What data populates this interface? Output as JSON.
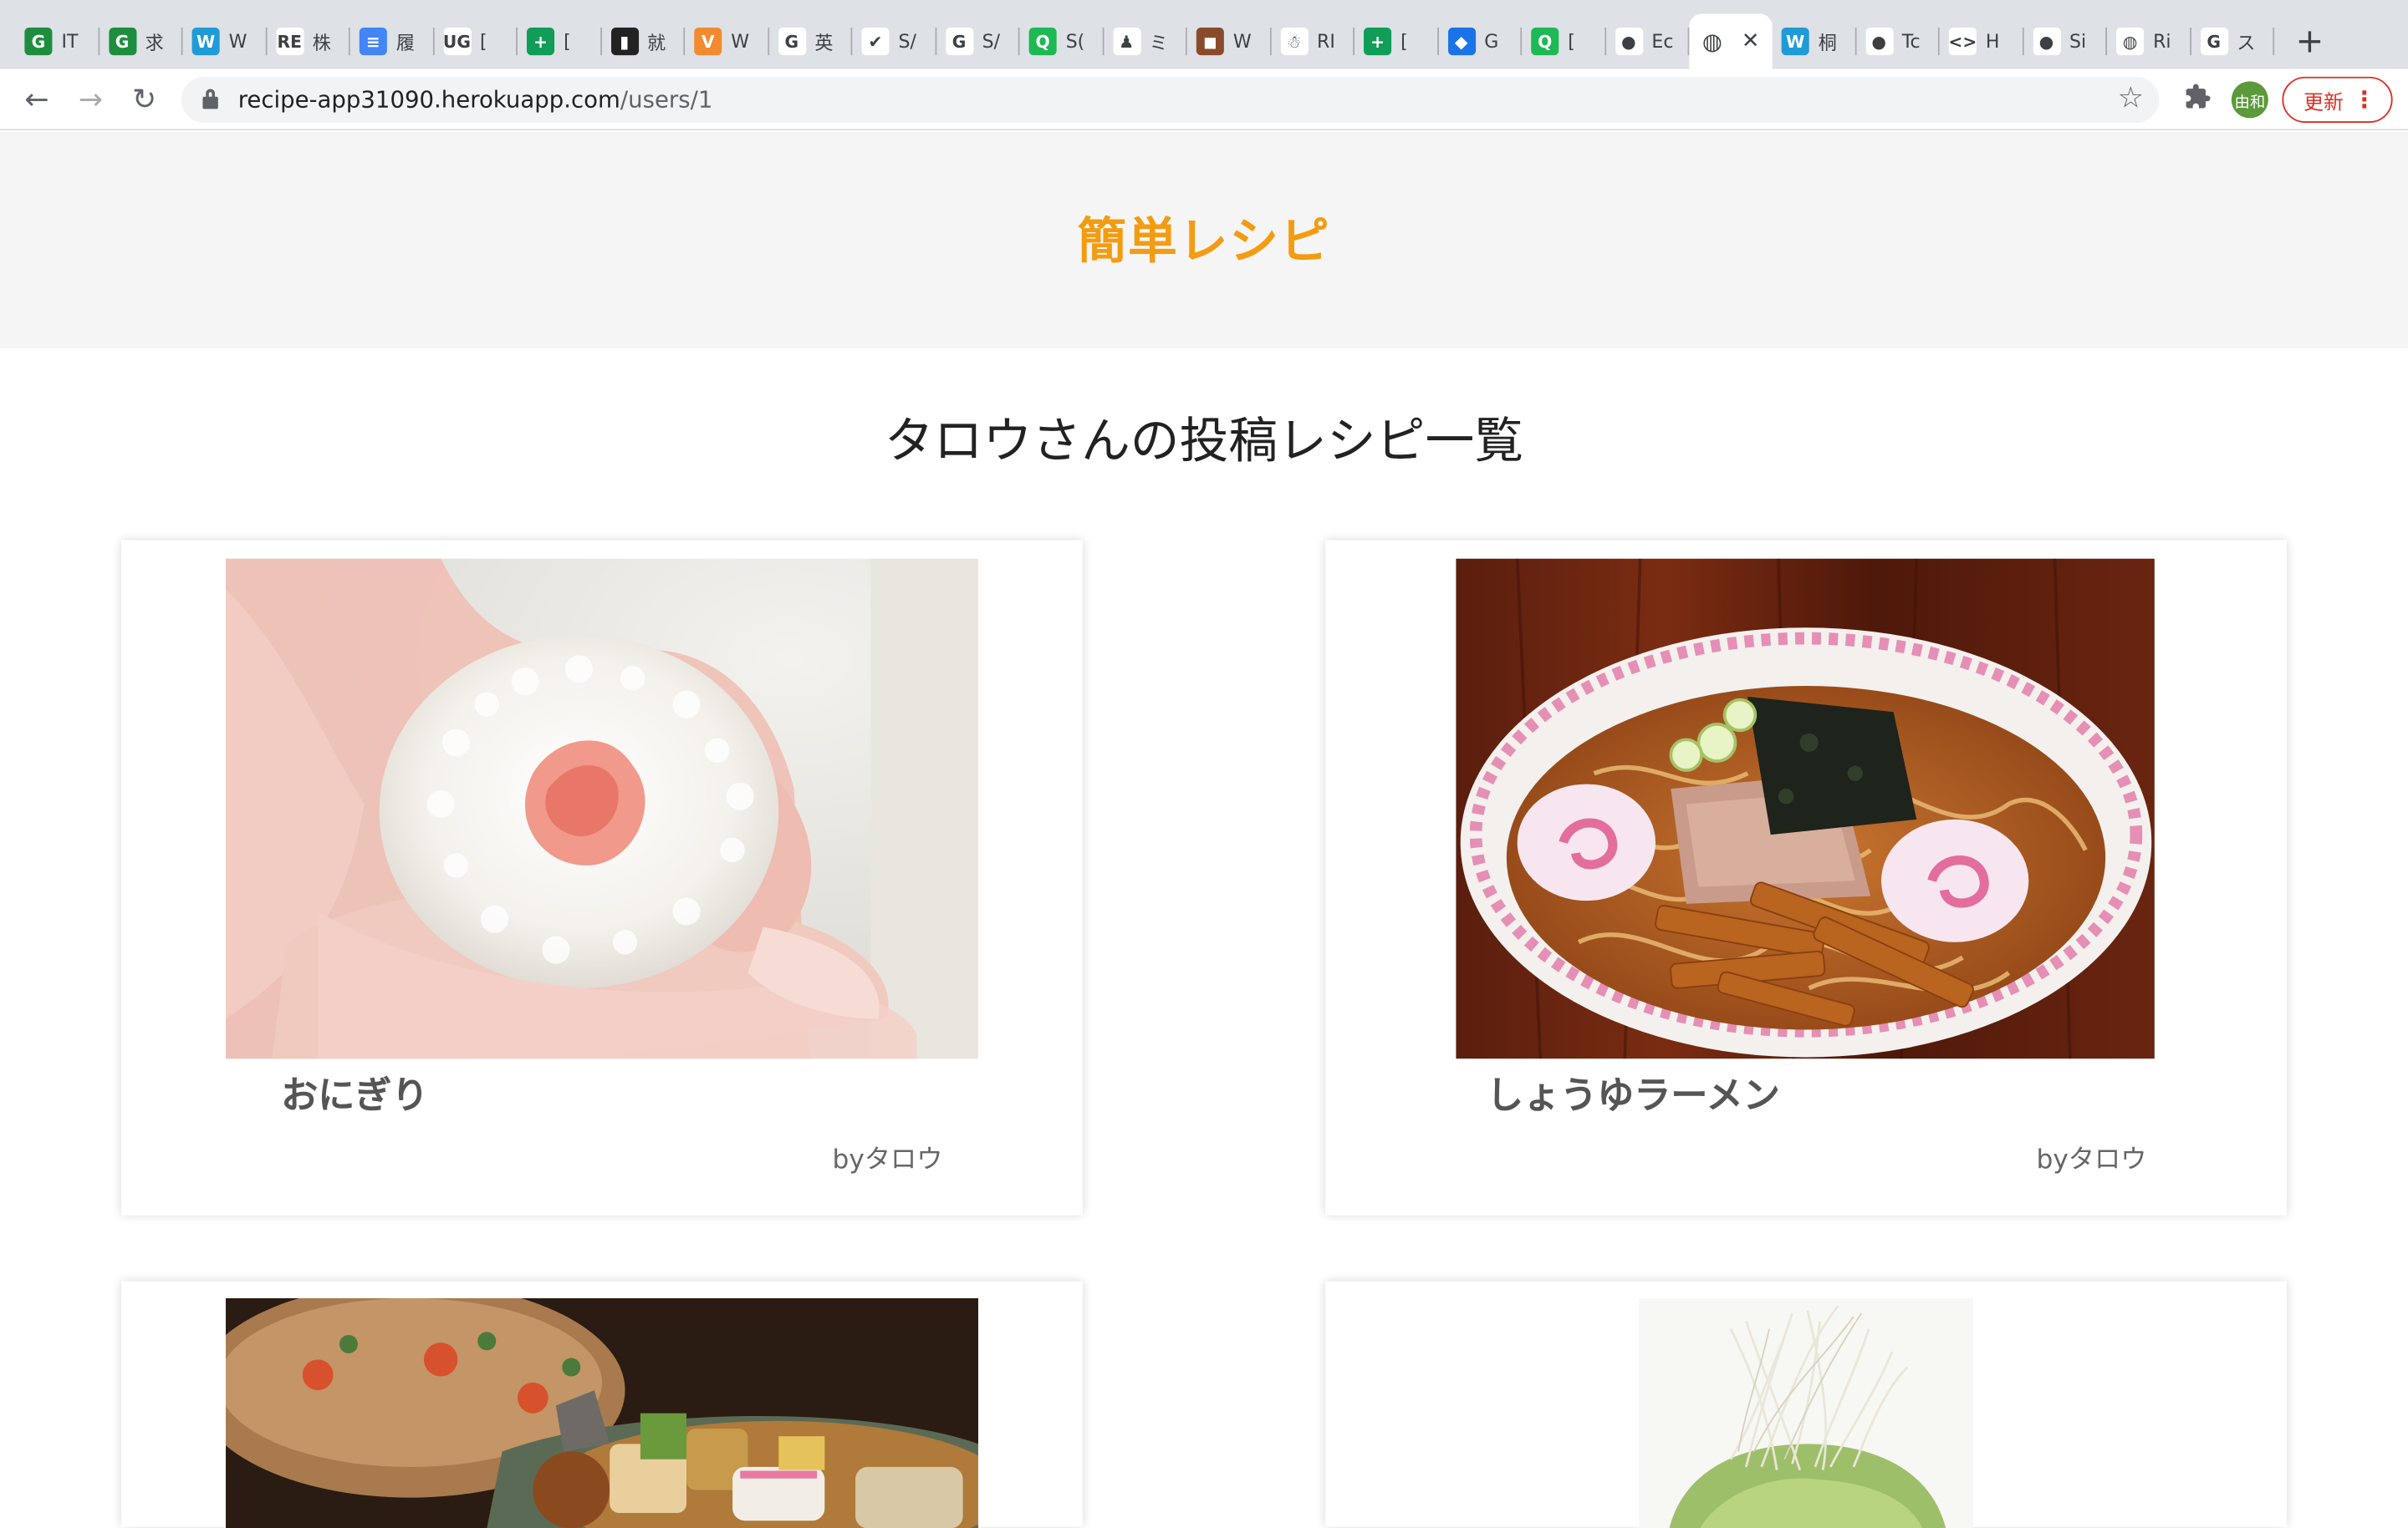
{
  "browser": {
    "tabs": [
      {
        "favicon": "green-g-icon",
        "color": "#1e8e3e",
        "glyph": "G",
        "label": "IT"
      },
      {
        "favicon": "green-g-icon",
        "color": "#1e8e3e",
        "glyph": "G",
        "label": "求"
      },
      {
        "favicon": "w-icon",
        "color": "#1f9bd8",
        "glyph": "W",
        "label": "W"
      },
      {
        "favicon": "re-icon",
        "color": "#ffffff",
        "glyph": "RE",
        "label": "株"
      },
      {
        "favicon": "docs-icon",
        "color": "#4285f4",
        "glyph": "≡",
        "label": "履"
      },
      {
        "favicon": "ug-icon",
        "color": "#ffffff",
        "glyph": "UG",
        "label": "["
      },
      {
        "favicon": "sheets-icon",
        "color": "#0f9d58",
        "glyph": "+",
        "label": "["
      },
      {
        "favicon": "book-icon",
        "color": "#222222",
        "glyph": "▮",
        "label": "就"
      },
      {
        "favicon": "v-icon",
        "color": "#f28b30",
        "glyph": "V",
        "label": "W"
      },
      {
        "favicon": "google-icon",
        "color": "#ffffff",
        "glyph": "G",
        "label": "英"
      },
      {
        "favicon": "check-icon",
        "color": "#ffffff",
        "glyph": "✔",
        "label": "S/"
      },
      {
        "favicon": "google-icon",
        "color": "#ffffff",
        "glyph": "G",
        "label": "S/"
      },
      {
        "favicon": "q-icon",
        "color": "#1db954",
        "glyph": "Q",
        "label": "S("
      },
      {
        "favicon": "figure-icon",
        "color": "#ffffff",
        "glyph": "♟",
        "label": "ミ"
      },
      {
        "favicon": "photo-icon",
        "color": "#8a4b2c",
        "glyph": "◼",
        "label": "W"
      },
      {
        "favicon": "santa-icon",
        "color": "#ffffff",
        "glyph": "☃",
        "label": "RI"
      },
      {
        "favicon": "sheets-icon",
        "color": "#0f9d58",
        "glyph": "+",
        "label": "["
      },
      {
        "favicon": "blue-square-icon",
        "color": "#1a73e8",
        "glyph": "◆",
        "label": "G"
      },
      {
        "favicon": "q-icon",
        "color": "#1db954",
        "glyph": "Q",
        "label": "["
      },
      {
        "favicon": "github-icon",
        "color": "#ffffff",
        "glyph": "●",
        "label": "Ec"
      }
    ],
    "active_tab": {
      "favicon": "globe-icon",
      "glyph": "◍"
    },
    "tabs_after": [
      {
        "favicon": "w-icon",
        "color": "#1f9bd8",
        "glyph": "W",
        "label": "桐"
      },
      {
        "favicon": "github-icon",
        "color": "#ffffff",
        "glyph": "●",
        "label": "Tc"
      },
      {
        "favicon": "code-icon",
        "color": "#ffffff",
        "glyph": "<>",
        "label": "H"
      },
      {
        "favicon": "github-icon",
        "color": "#ffffff",
        "glyph": "●",
        "label": "Si"
      },
      {
        "favicon": "globe-icon",
        "color": "#ffffff",
        "glyph": "◍",
        "label": "Ri"
      },
      {
        "favicon": "google-icon",
        "color": "#ffffff",
        "glyph": "G",
        "label": "ス"
      }
    ],
    "url_host": "recipe-app31090.herokuapp.com",
    "url_path": "/users/1",
    "avatar_text": "由和",
    "update_label": "更新"
  },
  "site": {
    "logo": "簡単レシピ",
    "page_title": "タロウさんの投稿レシピ一覧"
  },
  "recipes": [
    {
      "name": "おにぎり",
      "author": "byタロウ",
      "image": "onigiri-photo"
    },
    {
      "name": "しょうゆラーメン",
      "author": "byタロウ",
      "image": "ramen-photo"
    },
    {
      "name": "",
      "author": "",
      "image": "oden-photo"
    },
    {
      "name": "",
      "author": "",
      "image": "salad-photo"
    }
  ],
  "colors": {
    "logo": "#f39c12",
    "header_bg": "#f5f5f5",
    "update_red": "#d93025"
  }
}
